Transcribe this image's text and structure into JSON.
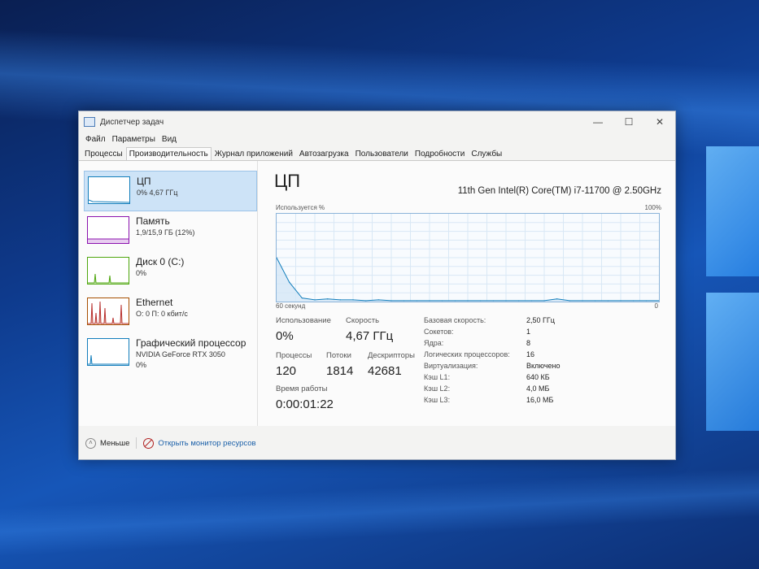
{
  "window": {
    "title": "Диспетчер задач",
    "controls": {
      "minimize": "—",
      "maximize": "☐",
      "close": "✕"
    }
  },
  "menu": [
    "Файл",
    "Параметры",
    "Вид"
  ],
  "tabs": [
    {
      "label": "Процессы",
      "active": false
    },
    {
      "label": "Производительность",
      "active": true
    },
    {
      "label": "Журнал приложений",
      "active": false
    },
    {
      "label": "Автозагрузка",
      "active": false
    },
    {
      "label": "Пользователи",
      "active": false
    },
    {
      "label": "Подробности",
      "active": false
    },
    {
      "label": "Службы",
      "active": false
    }
  ],
  "sidebar": {
    "items": [
      {
        "title": "ЦП",
        "sub1": "0% 4,67 ГГц",
        "sub2": "",
        "color": "#117dbb",
        "active": true
      },
      {
        "title": "Память",
        "sub1": "1,9/15,9 ГБ (12%)",
        "sub2": "",
        "color": "#8b12ae",
        "active": false
      },
      {
        "title": "Диск 0 (C:)",
        "sub1": "0%",
        "sub2": "",
        "color": "#4da60c",
        "active": false
      },
      {
        "title": "Ethernet",
        "sub1": "О: 0 П: 0 кбит/с",
        "sub2": "",
        "color": "#a74f01",
        "active": false
      },
      {
        "title": "Графический процессор",
        "sub1": "NVIDIA GeForce RTX 3050",
        "sub2": "0%",
        "color": "#117dbb",
        "active": false
      }
    ]
  },
  "main": {
    "title": "ЦП",
    "cpu_name": "11th Gen Intel(R) Core(TM) i7-11700 @ 2.50GHz",
    "graph_top_left": "Используется %",
    "graph_top_right": "100%",
    "graph_bottom_left": "60 секунд",
    "graph_bottom_right": "0",
    "stats": {
      "usage_label": "Использование",
      "usage_value": "0%",
      "speed_label": "Скорость",
      "speed_value": "4,67 ГГц",
      "processes_label": "Процессы",
      "processes_value": "120",
      "threads_label": "Потоки",
      "threads_value": "1814",
      "handles_label": "Дескрипторы",
      "handles_value": "42681",
      "uptime_label": "Время работы",
      "uptime_value": "0:00:01:22"
    },
    "properties": [
      {
        "key": "Базовая скорость:",
        "value": "2,50 ГГц"
      },
      {
        "key": "Сокетов:",
        "value": "1"
      },
      {
        "key": "Ядра:",
        "value": "8"
      },
      {
        "key": "Логических процессоров:",
        "value": "16"
      },
      {
        "key": "Виртуализация:",
        "value": "Включено"
      },
      {
        "key": "Кэш L1:",
        "value": "640 КБ"
      },
      {
        "key": "Кэш L2:",
        "value": "4,0 МБ"
      },
      {
        "key": "Кэш L3:",
        "value": "16,0 МБ"
      }
    ]
  },
  "footer": {
    "less_label": "Меньше",
    "resmon_label": "Открыть монитор ресурсов"
  },
  "chart_data": {
    "type": "area",
    "x": [
      60,
      58,
      56,
      54,
      52,
      50,
      48,
      46,
      44,
      42,
      40,
      38,
      36,
      34,
      32,
      30,
      28,
      26,
      24,
      22,
      20,
      18,
      16,
      14,
      12,
      10,
      8,
      6,
      4,
      2,
      0
    ],
    "values": [
      50,
      22,
      4,
      2,
      3,
      2,
      2,
      1,
      2,
      1,
      1,
      1,
      1,
      1,
      1,
      1,
      1,
      1,
      1,
      1,
      1,
      1,
      3,
      1,
      1,
      1,
      1,
      1,
      1,
      1,
      1
    ],
    "ylim": [
      0,
      100
    ],
    "color": "#117dbb"
  }
}
